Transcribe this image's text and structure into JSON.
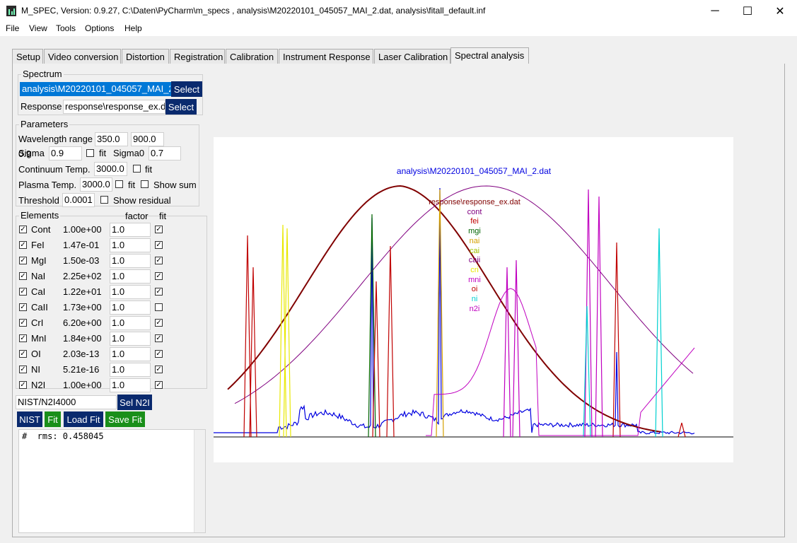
{
  "window": {
    "title": "M_SPEC, Version: 0.9.27, C:\\Daten\\PyCharm\\m_specs , analysis\\M20220101_045057_MAI_2.dat, analysis\\fitall_default.inf",
    "minimize_glyph": "─",
    "maximize_glyph": "☐",
    "close_glyph": "✕"
  },
  "menu": [
    "File",
    "View",
    "Tools",
    "Options",
    "Help"
  ],
  "tabs": [
    "Setup",
    "Video conversion",
    "Distortion",
    "Registration",
    "Calibration",
    "Instrument Response",
    "Laser Calibration",
    "Spectral analysis"
  ],
  "active_tab": "Spectral analysis",
  "spectrum": {
    "group_title": "Spectrum",
    "file_value": "analysis\\M20220101_045057_MAI_2.dat",
    "select_label": "Select",
    "response_label": "Response",
    "response_value": "response\\response_ex.dat",
    "response_select_label": "Select"
  },
  "parameters": {
    "group_title": "Parameters",
    "wavelength_label": "Wavelength range",
    "wl_min": "350.0",
    "wl_max": "900.0",
    "sigma_label": "Sigma",
    "sigma": "0.9",
    "fit_label": "fit",
    "sigma0_label": "Sigma0",
    "sigma0": "0.7",
    "cont_temp_label": "Continuum Temp.",
    "cont_temp": "3000.0",
    "plasma_temp_label": "Plasma Temp.",
    "plasma_temp": "3000.0",
    "show_sum_label": "Show sum",
    "threshold_label": "Threshold",
    "threshold": "0.0001",
    "show_residual_label": "Show residual"
  },
  "elements": {
    "group_title": "Elements",
    "factor_header": "factor",
    "fit_header": "fit",
    "rows": [
      {
        "name": "Cont",
        "value": "1.00e+00",
        "factor": "1.0",
        "checked": true,
        "fit": true
      },
      {
        "name": "FeI",
        "value": "1.47e-01",
        "factor": "1.0",
        "checked": true,
        "fit": true
      },
      {
        "name": "MgI",
        "value": "1.50e-03",
        "factor": "1.0",
        "checked": true,
        "fit": true
      },
      {
        "name": "NaI",
        "value": "2.25e+02",
        "factor": "1.0",
        "checked": true,
        "fit": true
      },
      {
        "name": "CaI",
        "value": "1.22e+01",
        "factor": "1.0",
        "checked": true,
        "fit": true
      },
      {
        "name": "CaII",
        "value": "1.73e+00",
        "factor": "1.0",
        "checked": true,
        "fit": false
      },
      {
        "name": "CrI",
        "value": "6.20e+00",
        "factor": "1.0",
        "checked": true,
        "fit": true
      },
      {
        "name": "MnI",
        "value": "1.84e+00",
        "factor": "1.0",
        "checked": true,
        "fit": true
      },
      {
        "name": "OI",
        "value": "2.03e-13",
        "factor": "1.0",
        "checked": true,
        "fit": true
      },
      {
        "name": "NI",
        "value": "5.21e-16",
        "factor": "1.0",
        "checked": true,
        "fit": true
      },
      {
        "name": "N2I",
        "value": "1.00e+00",
        "factor": "1.0",
        "checked": true,
        "fit": true
      }
    ]
  },
  "nist": {
    "value": "NIST/N2I4000",
    "sel_label": "Sel N2I"
  },
  "actions": {
    "nist": "NIST",
    "fit": "Fit",
    "load_fit": "Load Fit",
    "save_fit": "Save Fit"
  },
  "output_text": "#  rms: 0.458045",
  "plot": {
    "title": "analysis\\M20220101_045057_MAI_2.dat",
    "legend": [
      {
        "label": "response\\response_ex.dat",
        "color": "#800000"
      },
      {
        "label": "cont",
        "color": "#800080"
      },
      {
        "label": "fei",
        "color": "#c00000"
      },
      {
        "label": "mgi",
        "color": "#006400"
      },
      {
        "label": "nai",
        "color": "#d4a000"
      },
      {
        "label": "cai",
        "color": "#a0c000"
      },
      {
        "label": "caii",
        "color": "#800080"
      },
      {
        "label": "cri",
        "color": "#e8e800"
      },
      {
        "label": "mni",
        "color": "#c000c0"
      },
      {
        "label": "oi",
        "color": "#c00000"
      },
      {
        "label": "ni",
        "color": "#00d0d0"
      },
      {
        "label": "n2i",
        "color": "#c000c0"
      }
    ],
    "colors": {
      "measured": "#0000e0",
      "response": "#800000",
      "continuum": "#800080"
    }
  }
}
